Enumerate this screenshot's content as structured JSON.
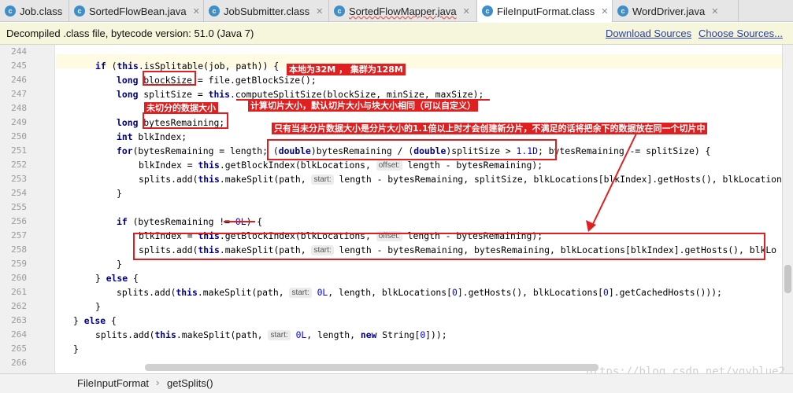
{
  "tabs": [
    {
      "label": "Job.class",
      "icon": "class-icon",
      "active": false,
      "wavy": false
    },
    {
      "label": "SortedFlowBean.java",
      "icon": "class-icon",
      "active": false,
      "wavy": false
    },
    {
      "label": "JobSubmitter.class",
      "icon": "class-icon",
      "active": false,
      "wavy": false
    },
    {
      "label": "SortedFlowMapper.java",
      "icon": "class-icon",
      "active": false,
      "wavy": true
    },
    {
      "label": "FileInputFormat.class",
      "icon": "class-icon",
      "active": true,
      "wavy": false
    },
    {
      "label": "WordDriver.java",
      "icon": "class-icon",
      "active": false,
      "wavy": false
    }
  ],
  "infobar": {
    "message": "Decompiled .class file, bytecode version: 51.0 (Java 7)",
    "download_sources": "Download Sources",
    "choose_sources": "Choose Sources..."
  },
  "line_numbers": [
    "244",
    "245",
    "246",
    "247",
    "248",
    "249",
    "250",
    "251",
    "252",
    "253",
    "254",
    "255",
    "256",
    "257",
    "258",
    "259",
    "260",
    "261",
    "262",
    "263",
    "264",
    "265",
    "266"
  ],
  "annotations": {
    "local_32m": "本地为32M ， 集群为128M",
    "compute_split": "计算切片大小，默认切片大小与块大小相同（可以自定义）",
    "unsplit_size": "未切分的数据大小",
    "rule_1_1": "只有当未分片数据大小是分片大小的1.1倍以上时才会创建新分片，不满足的话将把余下的数据放在同一个切片中"
  },
  "breadcrumb": {
    "class_name": "FileInputFormat",
    "method_name": "getSplits()"
  },
  "watermark": "https://blog.csdn.net/ygyblue2",
  "colors": {
    "annotation": "#e02020",
    "keyword": "#000080",
    "number": "#0000ff",
    "link": "#2a3fa8"
  }
}
